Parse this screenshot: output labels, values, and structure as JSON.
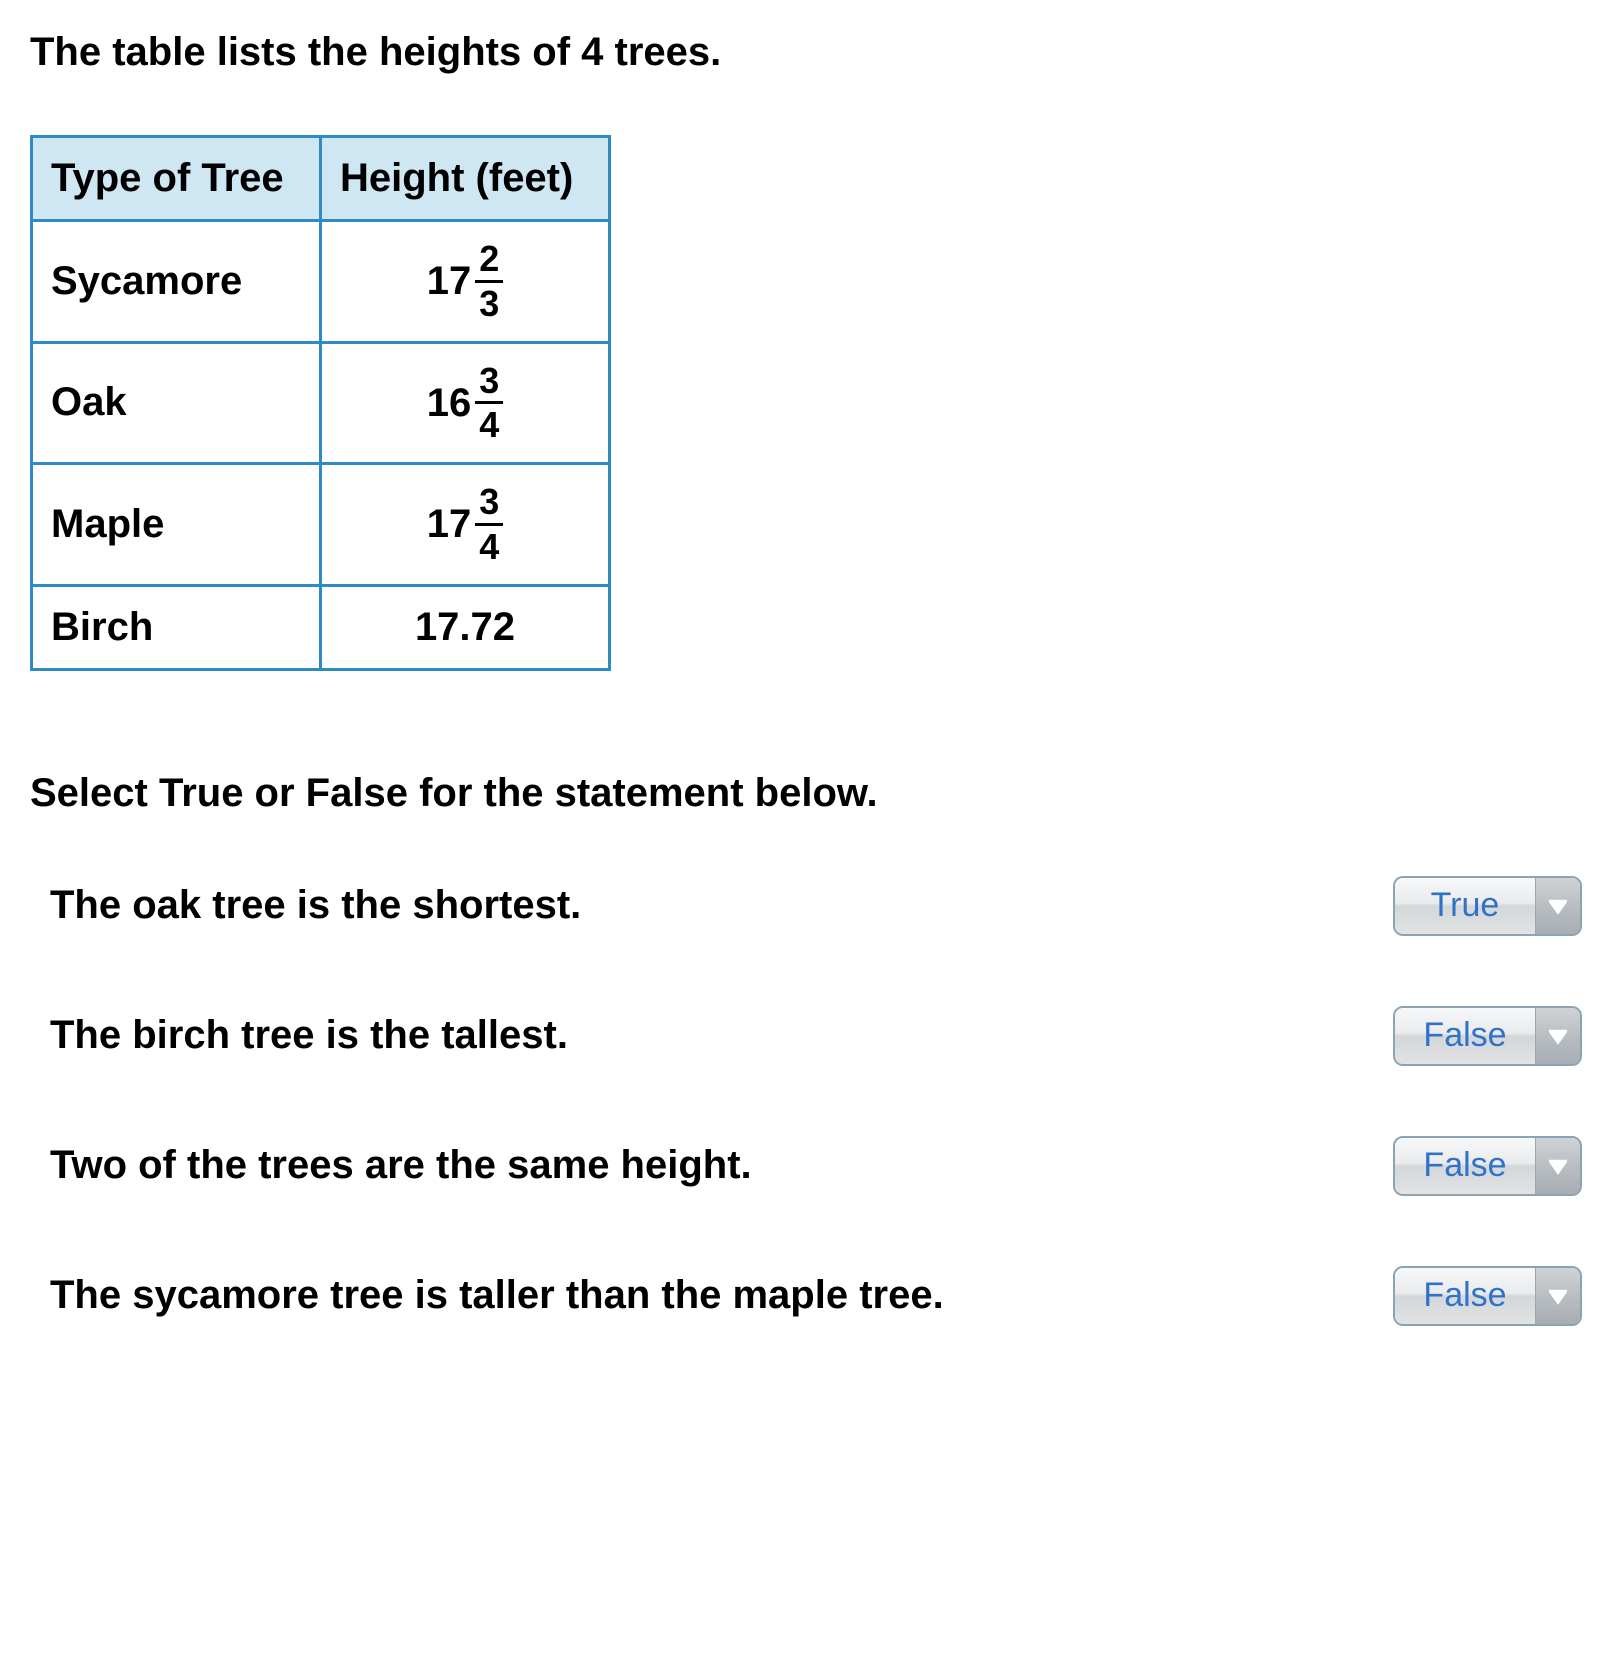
{
  "intro": "The table lists the heights of 4 trees.",
  "table": {
    "headers": [
      "Type of Tree",
      "Height (feet)"
    ],
    "rows": [
      {
        "tree": "Sycamore",
        "height_type": "mixed",
        "whole": "17",
        "num": "2",
        "den": "3"
      },
      {
        "tree": "Oak",
        "height_type": "mixed",
        "whole": "16",
        "num": "3",
        "den": "4"
      },
      {
        "tree": "Maple",
        "height_type": "mixed",
        "whole": "17",
        "num": "3",
        "den": "4"
      },
      {
        "tree": "Birch",
        "height_type": "decimal",
        "value": "17.72"
      }
    ]
  },
  "prompt": "Select True or False for the statement below.",
  "statements": [
    {
      "text": "The oak tree is the shortest.",
      "value": "True"
    },
    {
      "text": "The birch tree is the tallest.",
      "value": "False"
    },
    {
      "text": "Two of the trees are the same height.",
      "value": "False"
    },
    {
      "text": "The sycamore tree is taller than the maple tree.",
      "value": "False"
    }
  ],
  "chart_data": {
    "type": "table",
    "columns": [
      "Type of Tree",
      "Height (feet)"
    ],
    "rows": [
      [
        "Sycamore",
        "17 2/3"
      ],
      [
        "Oak",
        "16 3/4"
      ],
      [
        "Maple",
        "17 3/4"
      ],
      [
        "Birch",
        "17.72"
      ]
    ]
  }
}
